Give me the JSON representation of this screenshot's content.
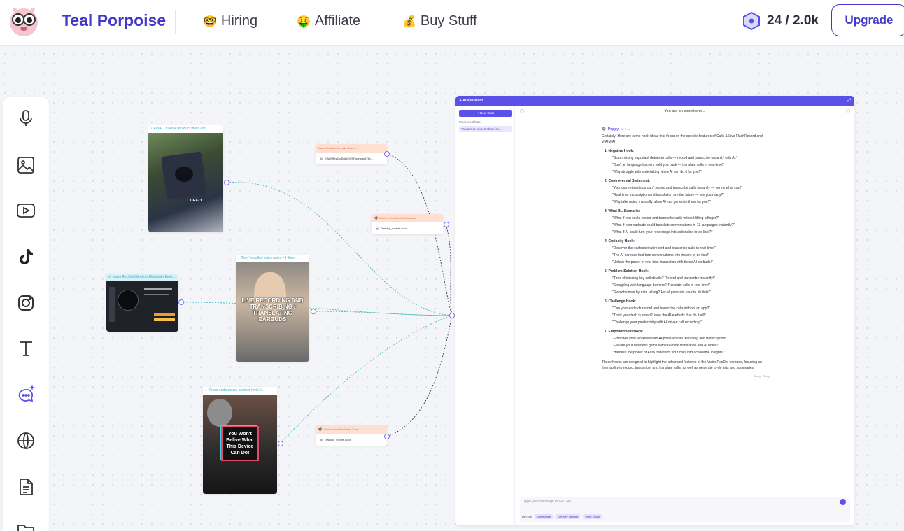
{
  "header": {
    "brand": "Teal Porpoise",
    "nav": [
      {
        "emoji": "🤓",
        "label": "Hiring"
      },
      {
        "emoji": "🤑",
        "label": "Affiliate"
      },
      {
        "emoji": "💰",
        "label": "Buy Stuff"
      }
    ],
    "credits": "24 / 2.0k",
    "upgrade_label": "Upgrade"
  },
  "toolbar": [
    "microphone-icon",
    "image-icon",
    "video-icon",
    "tiktok-icon",
    "instagram-icon",
    "text-icon",
    "ai-chat-icon",
    "globe-icon",
    "document-icon",
    "folder-icon"
  ],
  "canvas": {
    "video_nodes": [
      {
        "title": "FINALLY! An AI product that's act...",
        "caption": "CRAZY."
      },
      {
        "title": "viaim RecDot Wireless Bluetooth Earb...",
        "caption": ""
      },
      {
        "title": "They're called viaim notes + I likee...",
        "caption": "LIVE RECORDING AND TRANSCRIBING / TRANSLATING EARBUDS"
      },
      {
        "title": "These earbuds are another level. I...",
        "caption": "You Won't Belive What This Device Can Do!"
      }
    ],
    "doc_nodes": [
      {
        "title": "Viaim RecDot Earbuds Review",
        "file": "VIAIMRecDotBrief2025RurinsandTikt..."
      },
      {
        "title": "📽️AI Video Creation Masterclass",
        "file": "Training_scripts.docx"
      },
      {
        "title": "📽️AI Video Creation Made Easy",
        "file": "Training_scripts.docx"
      }
    ]
  },
  "ai": {
    "title": "AI Assistant",
    "new_chat": "+ New Chat",
    "previous_label": "Previous Chats",
    "previous_item": "You are an expert short-for...",
    "chat_title": "You are an expert sho...",
    "bot_name": "Poppy",
    "bot_model": "GPT-4o",
    "intro": "Certainly! Here are some hook ideas that focus on the specific features of Calls & Live FlashRecord and VIAIM AI:",
    "hooks": [
      {
        "title": "1.  Negative Hook:",
        "items": [
          "\"Stop missing important details in calls — record and transcribe instantly with AI.\"",
          "\"Don't let language barriers hold you back — translate calls in real-time!\"",
          "\"Why struggle with note-taking when AI can do it for you?\""
        ]
      },
      {
        "title": "2.  Controversial Statement:",
        "items": [
          "\"Your current earbuds can't record and transcribe calls instantly — here's what can!\"",
          "\"Real-time transcription and translation are the future — are you ready?\"",
          "\"Why take notes manually when AI can generate them for you?\""
        ]
      },
      {
        "title": "3.  What If... Scenario:",
        "items": [
          "\"What if you could record and transcribe calls without lifting a finger?\"",
          "\"What if your earbuds could translate conversations in 13 languages instantly?\"",
          "\"What if AI could turn your recordings into actionable to-do lists?\""
        ]
      },
      {
        "title": "4.  Curiosity Hook:",
        "items": [
          "\"Discover the earbuds that record and transcribe calls in real-time!\"",
          "\"The AI earbuds that turn conversations into instant to-do lists!\"",
          "\"Unlock the power of real-time translation with these AI earbuds!\""
        ]
      },
      {
        "title": "5.  Problem-Solution Hook:",
        "items": [
          "\"Tired of missing key call details? Record and transcribe instantly!\"",
          "\"Struggling with language barriers? Translate calls in real-time!\"",
          "\"Overwhelmed by note-taking? Let AI generate your to-do lists!\""
        ]
      },
      {
        "title": "6.  Challenge Hook:",
        "items": [
          "\"Can your earbuds record and transcribe calls without an app?\"",
          "\"Think your tech is smart? Meet the AI earbuds that do it all!\"",
          "\"Challenge your productivity with AI-driven call recording!\""
        ]
      },
      {
        "title": "7.  Empowerment Hook:",
        "items": [
          "\"Empower your workflow with AI-powered call recording and transcription!\"",
          "\"Elevate your business game with real-time translation and AI notes!\"",
          "\"Harness the power of AI to transform your calls into actionable insights!\""
        ]
      }
    ],
    "outro": "These hooks are designed to highlight the advanced features of the Viaim RecDot earbuds, focusing on their ability to record, transcribe, and translate calls, as well as generate to-do lists and summaries.",
    "copy": "Copy",
    "retry": "Retry",
    "placeholder": "Type your message to GPT-4o...",
    "model_select": "GPT-4o",
    "chips": [
      "Summarize",
      "Get Key Insights",
      "Write Email"
    ]
  },
  "colors": {
    "brand": "#4338ca",
    "accent": "#5b50e8",
    "edge": "#3fb6b8",
    "doc_title_bg": "#fde0d2"
  }
}
